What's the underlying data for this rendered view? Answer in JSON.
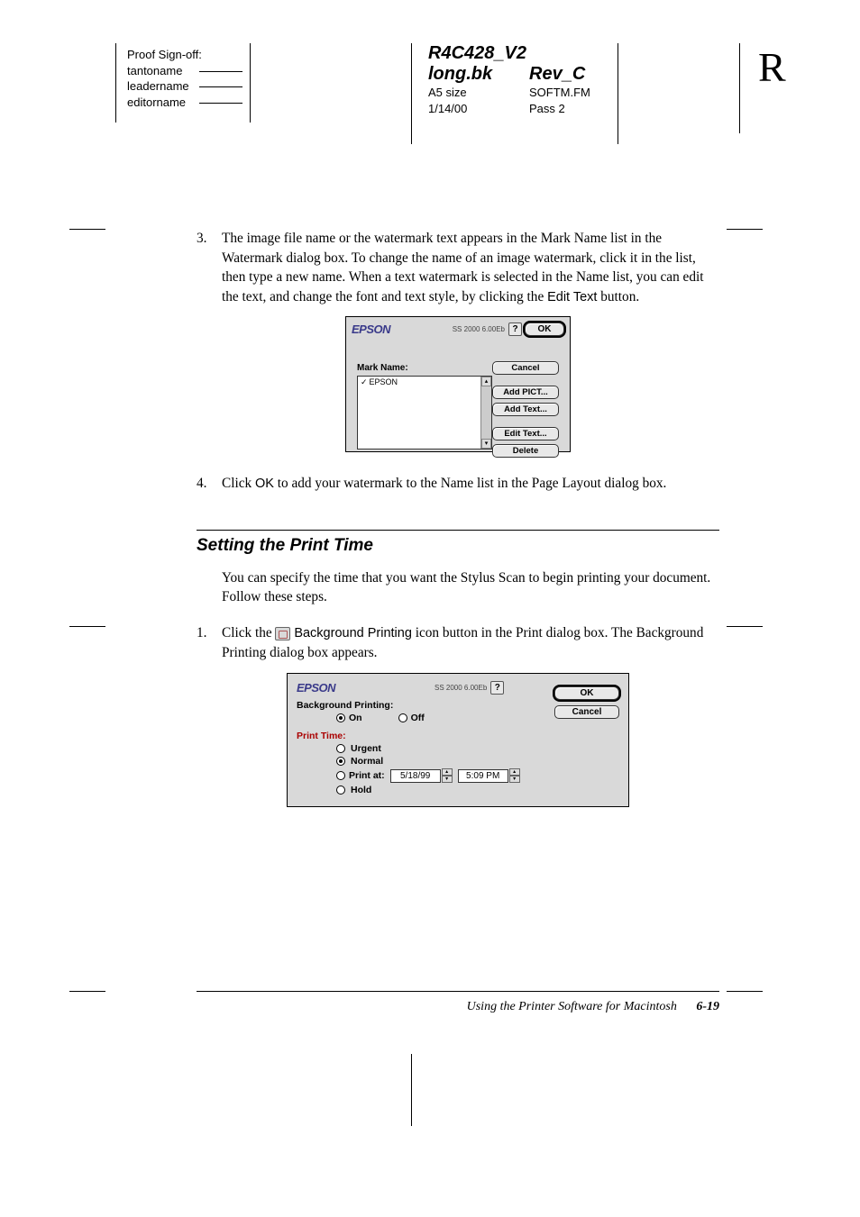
{
  "proof": {
    "title": "Proof Sign-off:",
    "lines": [
      "tantoname",
      "leadername",
      "editorname"
    ]
  },
  "doc": {
    "id": "R4C428_V2",
    "file": "long.bk",
    "rev": "Rev_C",
    "size": "A5 size",
    "meta1": "SOFTM.FM",
    "date": "1/14/00",
    "meta2": "Pass 2"
  },
  "bigLetter": "R",
  "step3": {
    "num": "3.",
    "text_a": "The image file name or the watermark text appears in the Mark Name list in the Watermark dialog box. To change the name of an image watermark, click it in the list, then type a new name. When a text watermark is selected in the Name list, you can edit the text, and change the font and text style, by clicking the ",
    "edit_text": "Edit Text",
    "text_b": " button."
  },
  "wmDialog": {
    "brand": "EPSON",
    "ver": "SS 2000 6.00Eb",
    "ok": "OK",
    "cancel": "Cancel",
    "markName": "Mark Name:",
    "item": "EPSON",
    "addPict": "Add PICT...",
    "addText": "Add Text...",
    "editText": "Edit Text...",
    "delete": "Delete"
  },
  "step4": {
    "num": "4.",
    "text_a": "Click ",
    "ok": "OK",
    "text_b": " to add your watermark to the Name list in the Page Layout dialog box."
  },
  "section": {
    "title": "Setting the Print Time",
    "intro": "You can specify the time that you want the Stylus Scan to begin printing your document. Follow these steps."
  },
  "step1b": {
    "num": "1.",
    "text_a": "Click the ",
    "bgPrinting": "Background Printing",
    "text_b": " icon button in the Print dialog box. The Background Printing dialog box appears."
  },
  "bgDialog": {
    "brand": "EPSON",
    "ver": "SS 2000 6.00Eb",
    "ok": "OK",
    "cancel": "Cancel",
    "bgPrinting": "Background Printing:",
    "on": "On",
    "off": "Off",
    "printTime": "Print Time:",
    "urgent": "Urgent",
    "normal": "Normal",
    "printAt": "Print at:",
    "date": "5/18/99",
    "time": "5:09 PM",
    "hold": "Hold"
  },
  "footer": {
    "chapter": "Using the Printer Software for Macintosh",
    "page": "6-19"
  }
}
